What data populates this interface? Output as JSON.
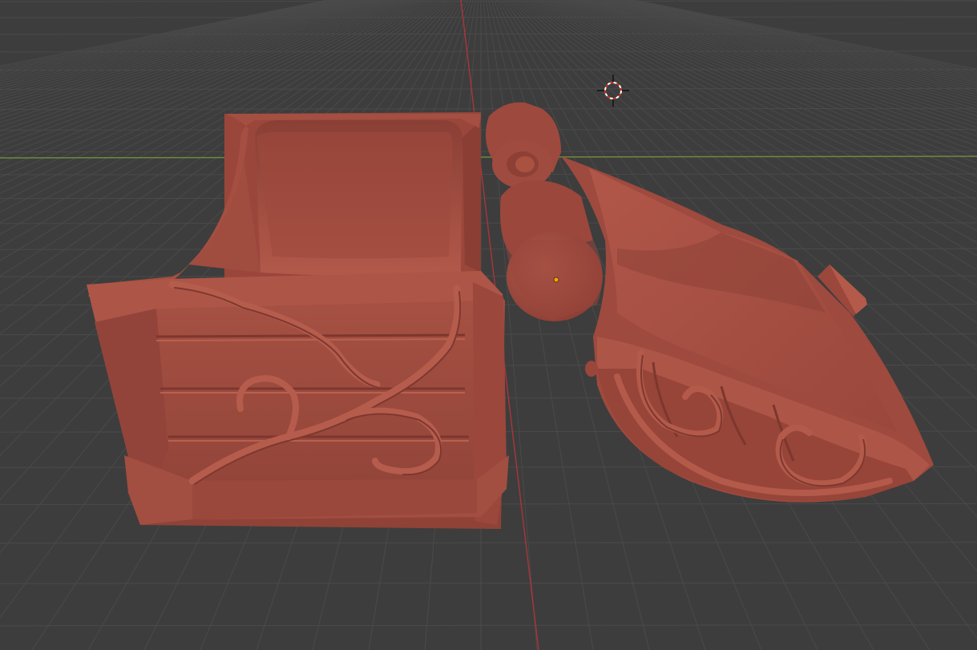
{
  "viewport": {
    "background_color": "#3d3d3d",
    "grid_color": "#4a4a4a",
    "x_axis_color": "#6f8f3a",
    "y_axis_color": "#a8383d"
  },
  "objects": [
    {
      "name": "chest-base",
      "color": "#9c4a40"
    },
    {
      "name": "chest-lid",
      "color": "#9c4a40"
    }
  ],
  "cursor": {
    "icon": "3d-cursor-icon"
  },
  "origin": {
    "color": "#ffa000"
  }
}
